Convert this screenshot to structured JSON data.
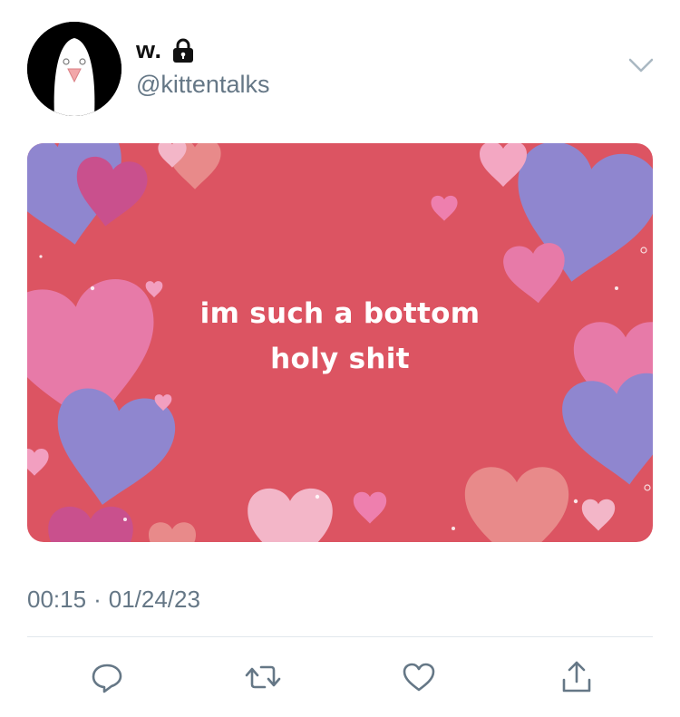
{
  "tweet": {
    "display_name": "w.",
    "handle": "@kittentalks",
    "media_caption_line1": "im such a bottom",
    "media_caption_line2": "holy shit",
    "time": "00:15",
    "separator": "·",
    "date": "01/24/23"
  },
  "icons": {
    "protected": "lock-icon",
    "menu": "chevron-down-icon",
    "reply": "reply-icon",
    "retweet": "retweet-icon",
    "like": "heart-icon",
    "share": "share-icon"
  },
  "colors": {
    "media_background": "#dc5462",
    "secondary_text": "#657786",
    "icon": "#657786"
  }
}
